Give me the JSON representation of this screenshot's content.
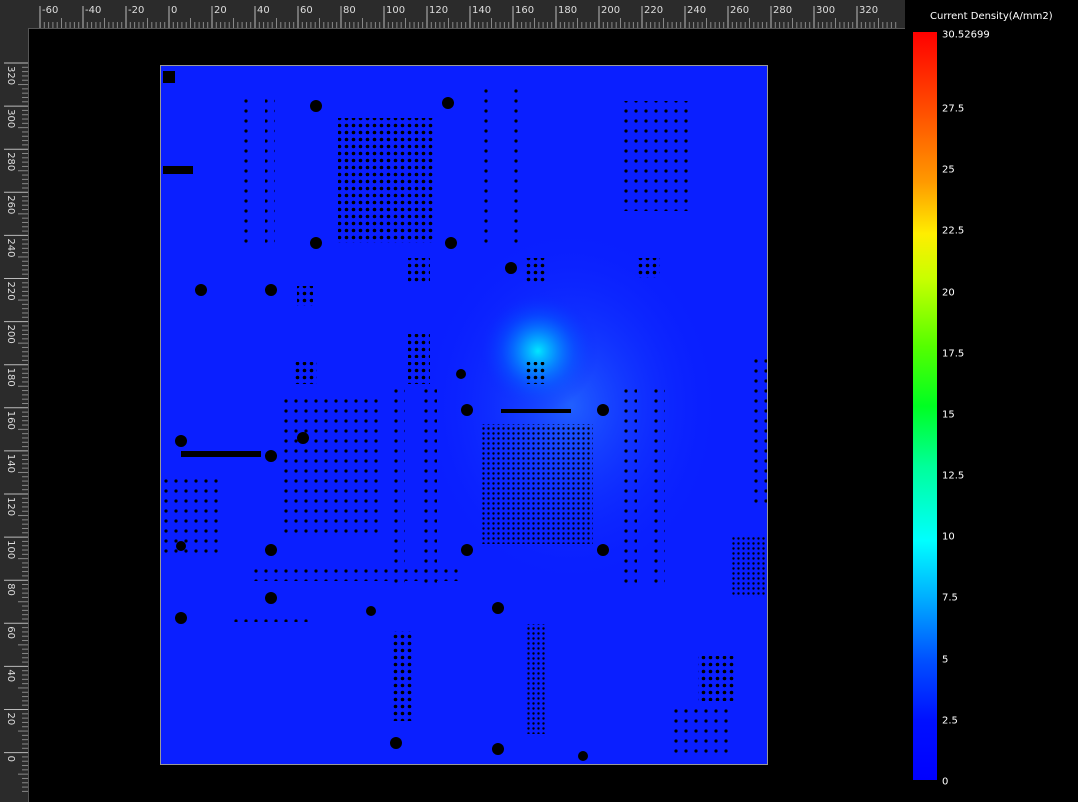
{
  "ruler": {
    "x_ticks": [
      "-60",
      "-40",
      "-20",
      "0",
      "20",
      "40",
      "60",
      "80",
      "100",
      "120",
      "140",
      "160",
      "180",
      "200",
      "220",
      "240",
      "260",
      "280",
      "300",
      "320"
    ],
    "y_ticks": [
      "320",
      "300",
      "280",
      "260",
      "240",
      "220",
      "200",
      "180",
      "160",
      "140",
      "120",
      "100",
      "80",
      "60",
      "40",
      "20",
      "0"
    ]
  },
  "legend": {
    "title": "Current Density(A/mm2)",
    "max_value": "30.52699",
    "ticks": [
      "27.5",
      "25",
      "22.5",
      "20",
      "17.5",
      "15",
      "12.5",
      "10",
      "7.5",
      "5",
      "2.5",
      "0"
    ],
    "colors": {
      "high": "#ff0000",
      "mid": "#00ff00",
      "low": "#0000ff"
    }
  },
  "board": {
    "background_color": "#0a1fff",
    "hotspot_color": "#00e5ff"
  }
}
